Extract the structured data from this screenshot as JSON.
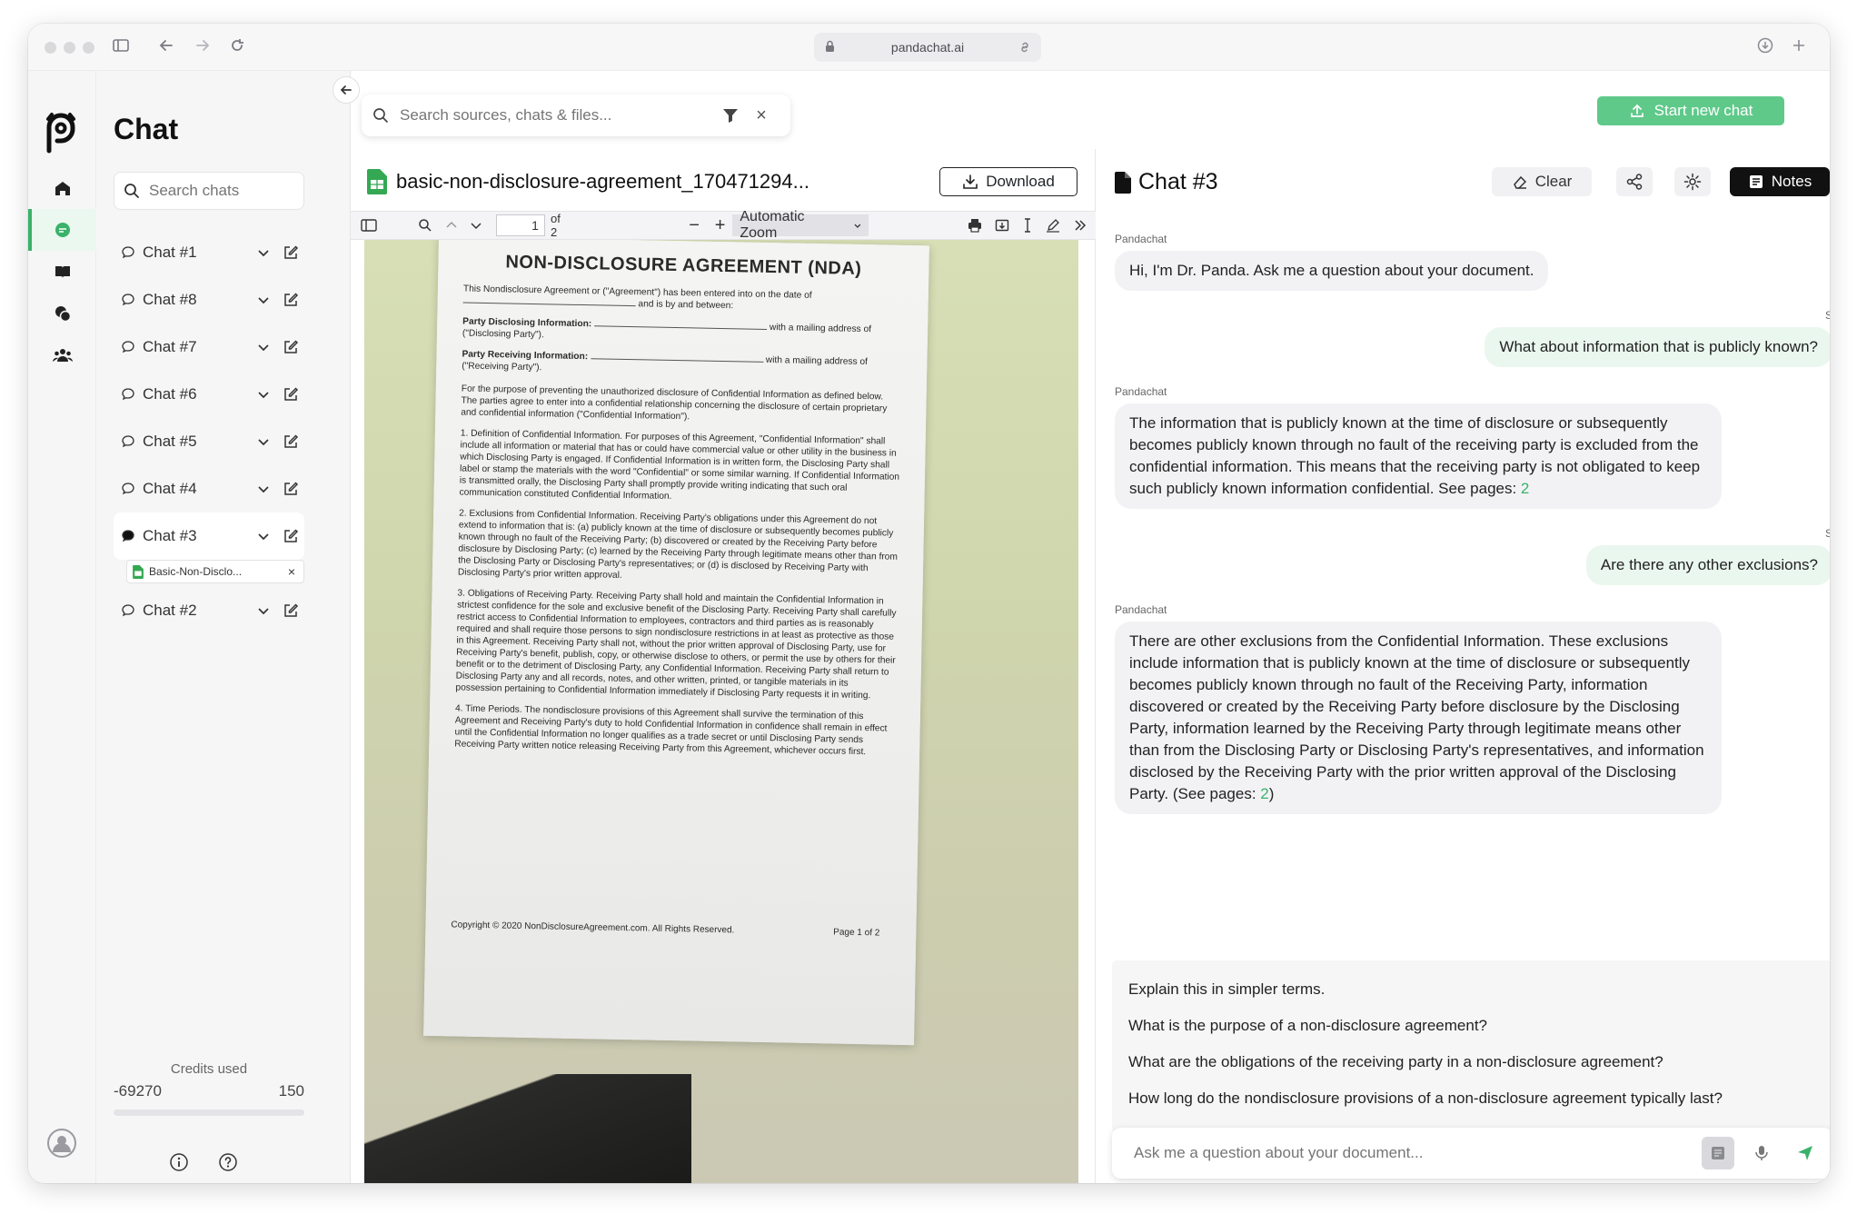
{
  "browser": {
    "url": "pandachat.ai"
  },
  "sidebar": {
    "title": "Chat",
    "search_placeholder": "Search chats",
    "chats": [
      {
        "label": "Chat #1"
      },
      {
        "label": "Chat #8"
      },
      {
        "label": "Chat #7"
      },
      {
        "label": "Chat #6"
      },
      {
        "label": "Chat #5"
      },
      {
        "label": "Chat #4"
      },
      {
        "label": "Chat #3",
        "active": true
      },
      {
        "label": "Chat #2"
      }
    ],
    "active_file": "Basic-Non-Disclo...",
    "credits_label": "Credits used",
    "credits_used": "-69270",
    "credits_total": "150"
  },
  "topbar": {
    "search_placeholder": "Search sources, chats & files...",
    "start_button": "Start new chat"
  },
  "doc": {
    "filename": "basic-non-disclosure-agreement_170471294...",
    "download_label": "Download",
    "page_number": "1",
    "page_total": "of 2",
    "zoom": "Automatic Zoom",
    "pdf": {
      "title": "NON-DISCLOSURE AGREEMENT (NDA)",
      "intro": "This Nondisclosure Agreement or (\"Agreement\") has been entered into on the date of",
      "intro2": "and is by and between:",
      "party_disclosing": "Party Disclosing Information:",
      "party_disclosing_tail": "with a mailing address of (\"Disclosing Party\").",
      "party_receiving": "Party Receiving Information:",
      "party_receiving_tail": "with a mailing address of (\"Receiving Party\").",
      "p_purpose": "For the purpose of preventing the unauthorized disclosure of Confidential Information as defined below. The parties agree to enter into a confidential relationship concerning the disclosure of certain proprietary and confidential information (\"Confidential Information\").",
      "s1": "1. Definition of Confidential Information. For purposes of this Agreement, \"Confidential Information\" shall include all information or material that has or could have commercial value or other utility in the business in which Disclosing Party is engaged. If Confidential Information is in written form, the Disclosing Party shall label or stamp the materials with the word \"Confidential\" or some similar warning. If Confidential Information is transmitted orally, the Disclosing Party shall promptly provide writing indicating that such oral communication constituted Confidential Information.",
      "s2": "2. Exclusions from Confidential Information. Receiving Party's obligations under this Agreement do not extend to information that is: (a) publicly known at the time of disclosure or subsequently becomes publicly known through no fault of the Receiving Party; (b) discovered or created by the Receiving Party before disclosure by Disclosing Party; (c) learned by the Receiving Party through legitimate means other than from the Disclosing Party or Disclosing Party's representatives; or (d) is disclosed by Receiving Party with Disclosing Party's prior written approval.",
      "s3": "3. Obligations of Receiving Party. Receiving Party shall hold and maintain the Confidential Information in strictest confidence for the sole and exclusive benefit of the Disclosing Party. Receiving Party shall carefully restrict access to Confidential Information to employees, contractors and third parties as is reasonably required and shall require those persons to sign nondisclosure restrictions in at least as protective as those in this Agreement. Receiving Party shall not, without the prior written approval of Disclosing Party, use for Receiving Party's benefit, publish, copy, or otherwise disclose to others, or permit the use by others for their benefit or to the detriment of Disclosing Party, any Confidential Information. Receiving Party shall return to Disclosing Party any and all records, notes, and other written, printed, or tangible materials in its possession pertaining to Confidential Information immediately if Disclosing Party requests it in writing.",
      "s4": "4. Time Periods. The nondisclosure provisions of this Agreement shall survive the termination of this Agreement and Receiving Party's duty to hold Confidential Information in confidence shall remain in effect until the Confidential Information no longer qualifies as a trade secret or until Disclosing Party sends Receiving Party written notice releasing Receiving Party from this Agreement, whichever occurs first.",
      "copyright": "Copyright © 2020 NonDisclosureAgreement.com. All Rights Reserved.",
      "page_label": "Page 1 of 2"
    }
  },
  "chat": {
    "title": "Chat #3",
    "clear_label": "Clear",
    "notes_label": "Notes",
    "messages": [
      {
        "from": "Pandachat",
        "text": "Hi, I'm Dr. Panda. Ask me a question about your document."
      },
      {
        "from": "S",
        "text": "What about information that is publicly known?"
      },
      {
        "from": "Pandachat",
        "text": "The information that is publicly known at the time of disclosure or subsequently becomes publicly known through no fault of the receiving party is excluded from the confidential information. This means that the receiving party is not obligated to keep such publicly known information confidential. See pages: ",
        "page": "2"
      },
      {
        "from": "S",
        "text": "Are there any other exclusions?"
      },
      {
        "from": "Pandachat",
        "text": "There are other exclusions from the Confidential Information. These exclusions include information that is publicly known at the time of disclosure or subsequently becomes publicly known through no fault of the Receiving Party, information discovered or created by the Receiving Party before disclosure by the Disclosing Party, information learned by the Receiving Party through legitimate means other than from the Disclosing Party or Disclosing Party's representatives, and information disclosed by the Receiving Party with the prior written approval of the Disclosing Party. (See pages: ",
        "page": "2",
        "tail": ")"
      }
    ],
    "suggestions": [
      "Explain this in simpler terms.",
      "What is the purpose of a non-disclosure agreement?",
      "What are the obligations of the receiving party in a non-disclosure agreement?",
      "How long do the nondisclosure provisions of a non-disclosure agreement typically last?"
    ],
    "input_placeholder": "Ask me a question about your document..."
  },
  "colors": {
    "accent": "#3bb16a",
    "start_button": "#5fc98a"
  }
}
